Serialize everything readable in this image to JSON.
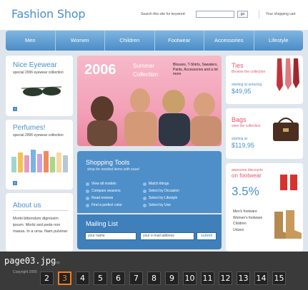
{
  "header": {
    "logo": "Fashion Shop",
    "search_label": "Search this site for keyword:",
    "search_value": "",
    "go_label": "go",
    "cart_label": "Your shopping cart"
  },
  "nav": [
    "Men",
    "Women",
    "Children",
    "Footwear",
    "Accessories",
    "Lifestyle"
  ],
  "left": {
    "eyewear_title": "Nice Eyewear",
    "eyewear_sub": "special 2006 eyewear collection",
    "perfumes_title": "Perfumes!",
    "perfumes_sub": "special 2006 eyewear collection",
    "about_title": "About us",
    "about_text": "Morbi bibendum dignissim ipsum. Morbi sed pede non massa. In a urna. Nam pulvinar"
  },
  "hero": {
    "year": "2006",
    "sub1": "Summer",
    "sub2": "Collection",
    "text": "Blouses, T-Shirts, Sweaters, Pants, Accessories and a lot more"
  },
  "tools": {
    "title": "Shopping Tools",
    "subtitle": "shop for needed items with ease!",
    "col1": [
      "View all models",
      "Compare seasons",
      "Read reviews",
      "Find a perfect color"
    ],
    "col2": [
      "Match things",
      "Select by Occasion",
      "Select by Lifestyle",
      "Select by Use"
    ]
  },
  "mailing": {
    "title": "Mailing List",
    "name_placeholder": "your name",
    "email_placeholder": "your e-mail address",
    "submit_label": "submit"
  },
  "right": {
    "ties_title": "Ties",
    "ties_sub": "Browse the collection",
    "ties_starting": "starting at amazing",
    "ties_price": "$49,95",
    "bags_title": "Bags",
    "bags_sub": "view the collection",
    "bags_starting": "starting at",
    "bags_price": "$119,95",
    "footwear_discount": "awesome discounts",
    "footwear_on": "on footwear",
    "footwear_percent": "3.5%",
    "footwear_list": [
      "Men's footware",
      "Women's footware",
      "Children",
      "Unisex"
    ]
  },
  "footer": {
    "filename": "page03.jpg",
    "shop_label": "Shop",
    "copyright": "Copyright 2005"
  },
  "pager": {
    "pages": [
      "2",
      "3",
      "4",
      "5",
      "6",
      "7",
      "8",
      "9",
      "10",
      "11",
      "12",
      "13",
      "14",
      "15"
    ],
    "active": "3"
  },
  "colors": {
    "accent": "#4a90c8",
    "pink": "#e05a6e",
    "active_page": "#f08020"
  }
}
